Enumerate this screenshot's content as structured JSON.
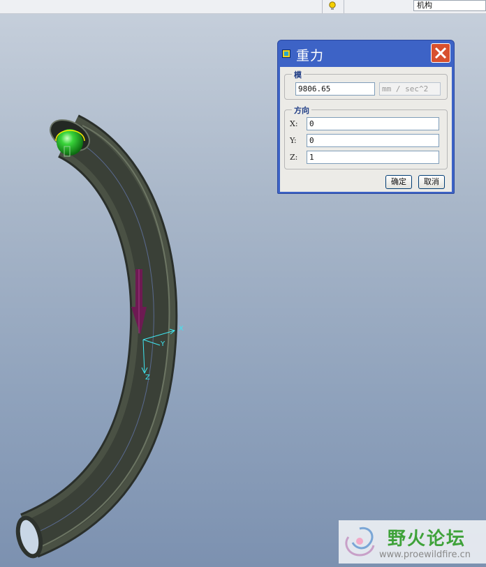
{
  "toolbar": {
    "mode_value": "机构"
  },
  "scene": {
    "axis_labels": {
      "x": "X",
      "y": "Y",
      "z": "Z"
    }
  },
  "dialog": {
    "title": "重力",
    "magnitude": {
      "group_label": "模",
      "value": "9806.65",
      "unit": "mm / sec^2"
    },
    "direction": {
      "group_label": "方向",
      "x_label": "X:",
      "x_value": "0",
      "y_label": "Y:",
      "y_value": "0",
      "z_label": "Z:",
      "z_value": "1"
    },
    "ok_label": "确定",
    "cancel_label": "取消"
  },
  "watermark": {
    "title": "野火论坛",
    "url": "www.proewildfire.cn"
  },
  "colors": {
    "dialog_frame": "#3d63c6",
    "close_button": "#d8502e",
    "gravity_arrow": "#6d1a52",
    "ball": "#22c32a",
    "axis_cyan": "#3fe6f0"
  }
}
